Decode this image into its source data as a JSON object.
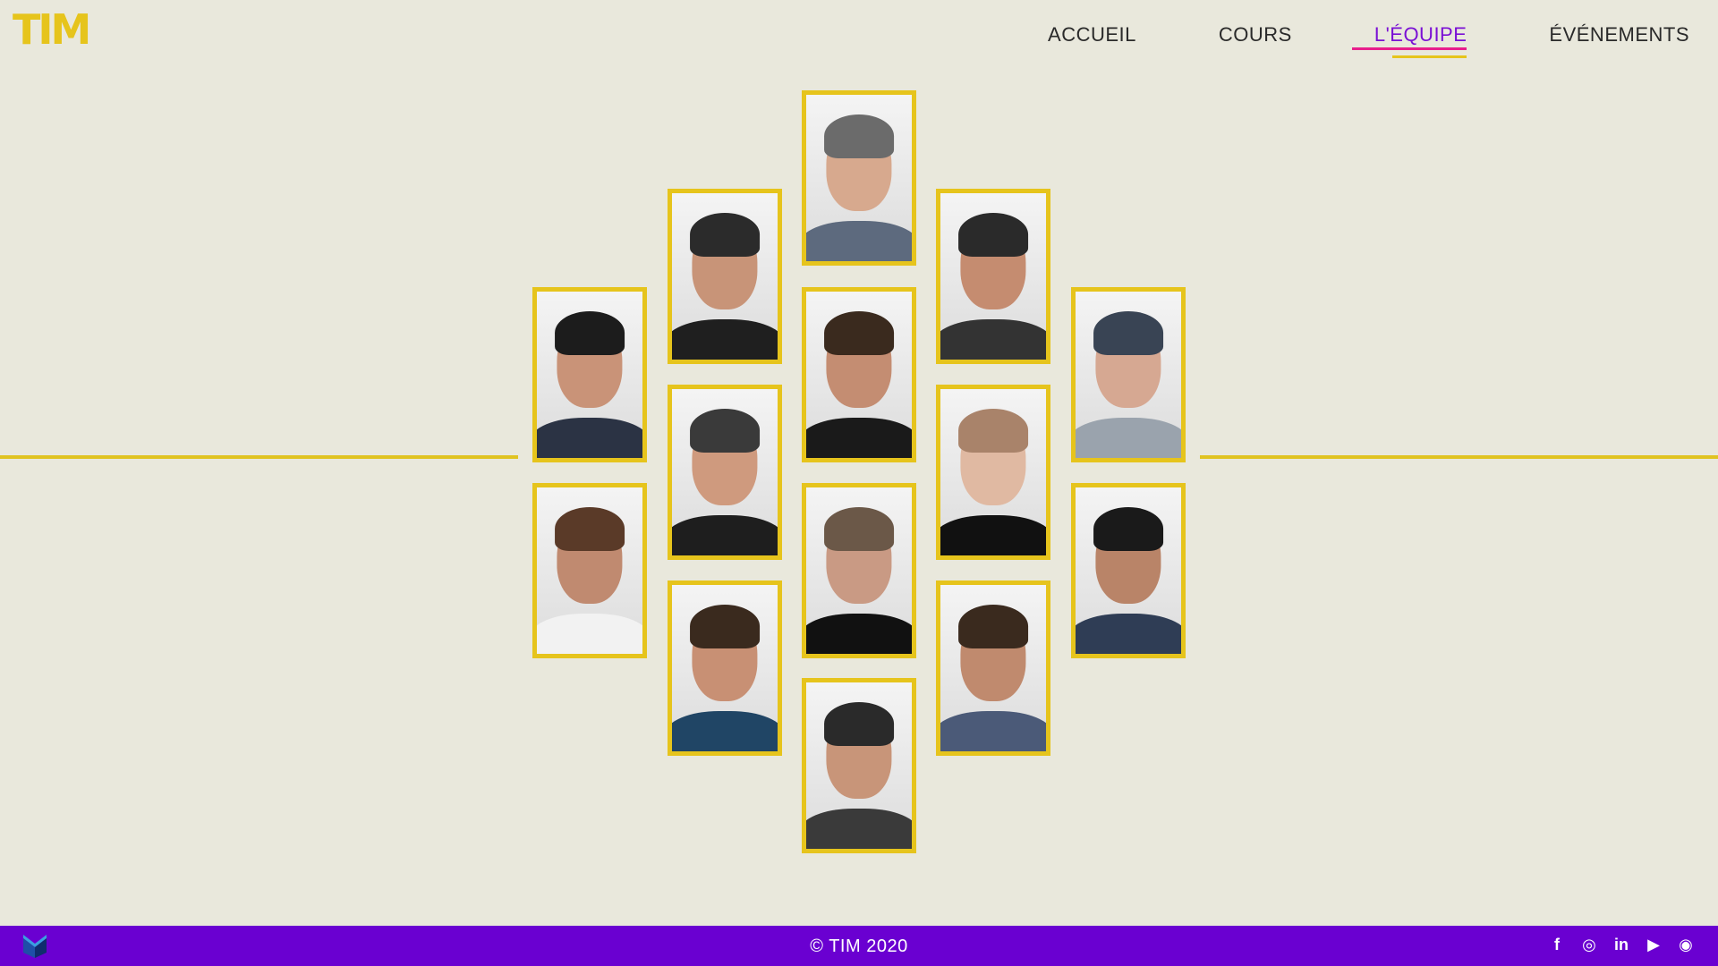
{
  "header": {
    "logo_text": "TIM",
    "nav": [
      {
        "label": "ACCUEIL",
        "active": false
      },
      {
        "label": "COURS",
        "active": false
      },
      {
        "label": "L'ÉQUIPE",
        "active": true
      },
      {
        "label": "ÉVÉNEMENTS",
        "active": false
      }
    ]
  },
  "colors": {
    "background": "#e9e8dc",
    "accent_yellow": "#e6c41c",
    "active_nav": "#7a10d4",
    "underline_pink": "#e81e8c",
    "footer": "#6a00d1"
  },
  "team": [
    {
      "name": "team-member-1"
    },
    {
      "name": "team-member-2"
    },
    {
      "name": "team-member-3"
    },
    {
      "name": "team-member-4"
    },
    {
      "name": "team-member-5"
    },
    {
      "name": "team-member-6"
    },
    {
      "name": "team-member-7"
    },
    {
      "name": "team-member-8"
    },
    {
      "name": "team-member-9"
    },
    {
      "name": "team-member-10"
    },
    {
      "name": "team-member-11"
    },
    {
      "name": "team-member-12"
    },
    {
      "name": "team-member-13"
    },
    {
      "name": "team-member-14"
    }
  ],
  "footer": {
    "copyright": "© TIM 2020",
    "socials": [
      {
        "icon": "facebook-icon",
        "glyph": "f"
      },
      {
        "icon": "instagram-icon",
        "glyph": "◎"
      },
      {
        "icon": "linkedin-icon",
        "glyph": "in"
      },
      {
        "icon": "youtube-icon",
        "glyph": "▶"
      },
      {
        "icon": "discord-icon",
        "glyph": "◉"
      }
    ]
  }
}
